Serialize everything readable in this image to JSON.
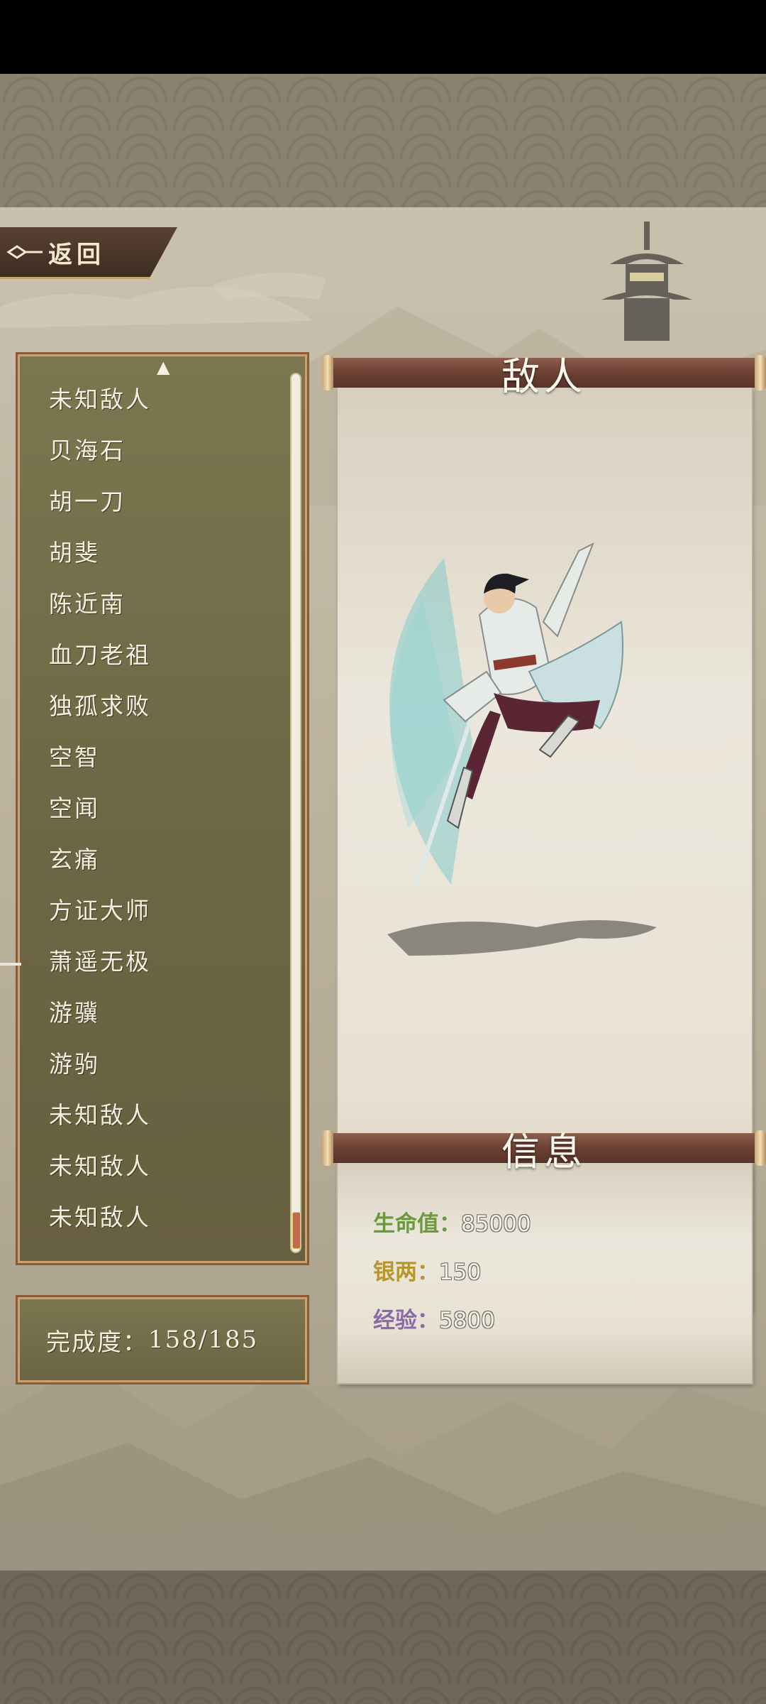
{
  "back_button": {
    "label": "返回"
  },
  "enemy_list": {
    "items": [
      "未知敌人",
      "贝海石",
      "胡一刀",
      "胡斐",
      "陈近南",
      "血刀老祖",
      "独孤求败",
      "空智",
      "空闻",
      "玄痛",
      "方证大师",
      "萧遥无极",
      "游骥",
      "游驹",
      "未知敌人",
      "未知敌人",
      "未知敌人"
    ],
    "selected_index": 11,
    "scroll_position_fraction": 1.0
  },
  "progress": {
    "label": "完成度：",
    "value": "158/185"
  },
  "enemy_panel": {
    "title": "敌人"
  },
  "info_panel": {
    "title": "信息",
    "hp": {
      "label": "生命值：",
      "value": "85000",
      "color": "#6b9a3c"
    },
    "silver": {
      "label": "银两：",
      "value": "150",
      "color": "#b8962e"
    },
    "exp": {
      "label": "经验：",
      "value": "5800",
      "color": "#8a6aa8"
    }
  }
}
